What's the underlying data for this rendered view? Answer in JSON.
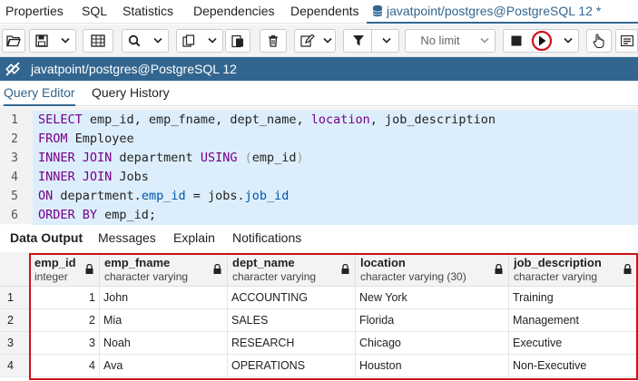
{
  "tabs": [
    {
      "label": "Properties"
    },
    {
      "label": "SQL"
    },
    {
      "label": "Statistics"
    },
    {
      "label": "Dependencies"
    },
    {
      "label": "Dependents"
    },
    {
      "label": "javatpoint/postgres@PostgreSQL 12 *",
      "active": true
    }
  ],
  "toolbar": {
    "limit_label": "No limit"
  },
  "connection": {
    "label": "javatpoint/postgres@PostgreSQL 12"
  },
  "editor_tabs": [
    "Query Editor",
    "Query History"
  ],
  "sql": {
    "line_numbers": [
      "1",
      "2",
      "3",
      "4",
      "5",
      "6"
    ],
    "l1": {
      "kw1": "SELECT",
      "a": " emp_id, emp_fname, dept_name, ",
      "kw2": "location",
      "b": ", job_description"
    },
    "l2": {
      "kw1": "FROM",
      "a": " Employee"
    },
    "l3": {
      "kw1": "INNER JOIN",
      "a": " department ",
      "kw2": "USING",
      "p1": " (",
      "b": "emp_id",
      "p2": ")"
    },
    "l4": {
      "kw1": "INNER JOIN",
      "a": " Jobs"
    },
    "l5": {
      "kw1": "ON",
      "a": " department.",
      "v1": "emp_id",
      "b": " = jobs.",
      "v2": "job_id"
    },
    "l6": {
      "kw1": "ORDER BY",
      "a": " emp_id;"
    }
  },
  "output_tabs": [
    "Data Output",
    "Messages",
    "Explain",
    "Notifications"
  ],
  "grid": {
    "columns": [
      {
        "name": "emp_id",
        "type": "integer"
      },
      {
        "name": "emp_fname",
        "type": "character varying"
      },
      {
        "name": "dept_name",
        "type": "character varying"
      },
      {
        "name": "location",
        "type": "character varying (30)"
      },
      {
        "name": "job_description",
        "type": "character varying"
      }
    ],
    "rows": [
      {
        "n": "1",
        "emp_id": "1",
        "emp_fname": "John",
        "dept_name": "ACCOUNTING",
        "location": "New York",
        "job_description": "Training"
      },
      {
        "n": "2",
        "emp_id": "2",
        "emp_fname": "Mia",
        "dept_name": "SALES",
        "location": "Florida",
        "job_description": "Management"
      },
      {
        "n": "3",
        "emp_id": "3",
        "emp_fname": "Noah",
        "dept_name": "RESEARCH",
        "location": "Chicago",
        "job_description": "Executive"
      },
      {
        "n": "4",
        "emp_id": "4",
        "emp_fname": "Ava",
        "dept_name": "OPERATIONS",
        "location": "Houston",
        "job_description": "Non-Executive"
      }
    ]
  },
  "colors": {
    "accent": "#326690",
    "highlight": "#d0101a",
    "keyword": "#770088",
    "variable": "#0055aa"
  },
  "icons": {
    "toolbar": [
      "open-folder-icon",
      "save-icon",
      "chevron-down-icon",
      "table-icon",
      "search-icon",
      "chevron-down-icon",
      "copy-icon",
      "chevron-down-icon",
      "paste-icon",
      "trash-icon",
      "edit-icon",
      "chevron-down-icon",
      "filter-icon",
      "chevron-down-icon",
      "stop-icon",
      "play-icon",
      "chevron-down-icon",
      "hand-icon",
      "card-icon"
    ]
  }
}
